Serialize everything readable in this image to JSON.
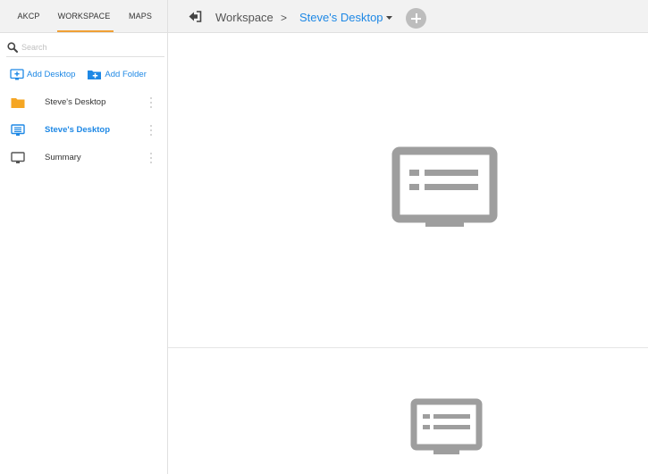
{
  "sidebar": {
    "tabs": [
      {
        "label": "AKCP"
      },
      {
        "label": "WORKSPACE",
        "active": true
      },
      {
        "label": "MAPS"
      }
    ],
    "search": {
      "placeholder": "Search",
      "value": ""
    },
    "actions": {
      "add_desktop": "Add Desktop",
      "add_folder": "Add Folder"
    },
    "items": [
      {
        "label": "Steve's Desktop",
        "icon": "folder-icon",
        "active": false
      },
      {
        "label": "Steve's Desktop",
        "icon": "desktop-list-icon",
        "active": true
      },
      {
        "label": "Summary",
        "icon": "monitor-icon",
        "active": false
      }
    ]
  },
  "breadcrumb": {
    "root": "Workspace",
    "separator": ">",
    "current": "Steve's Desktop"
  },
  "colors": {
    "accent": "#1e88e5",
    "tab_underline": "#f0a035",
    "folder": "#f5a623",
    "placeholder_icon": "#9e9e9e"
  },
  "icons": {
    "back": "sign-in-icon",
    "add": "plus-icon",
    "dropdown": "caret-down-icon",
    "panel_placeholder": "desktop-list-icon"
  }
}
